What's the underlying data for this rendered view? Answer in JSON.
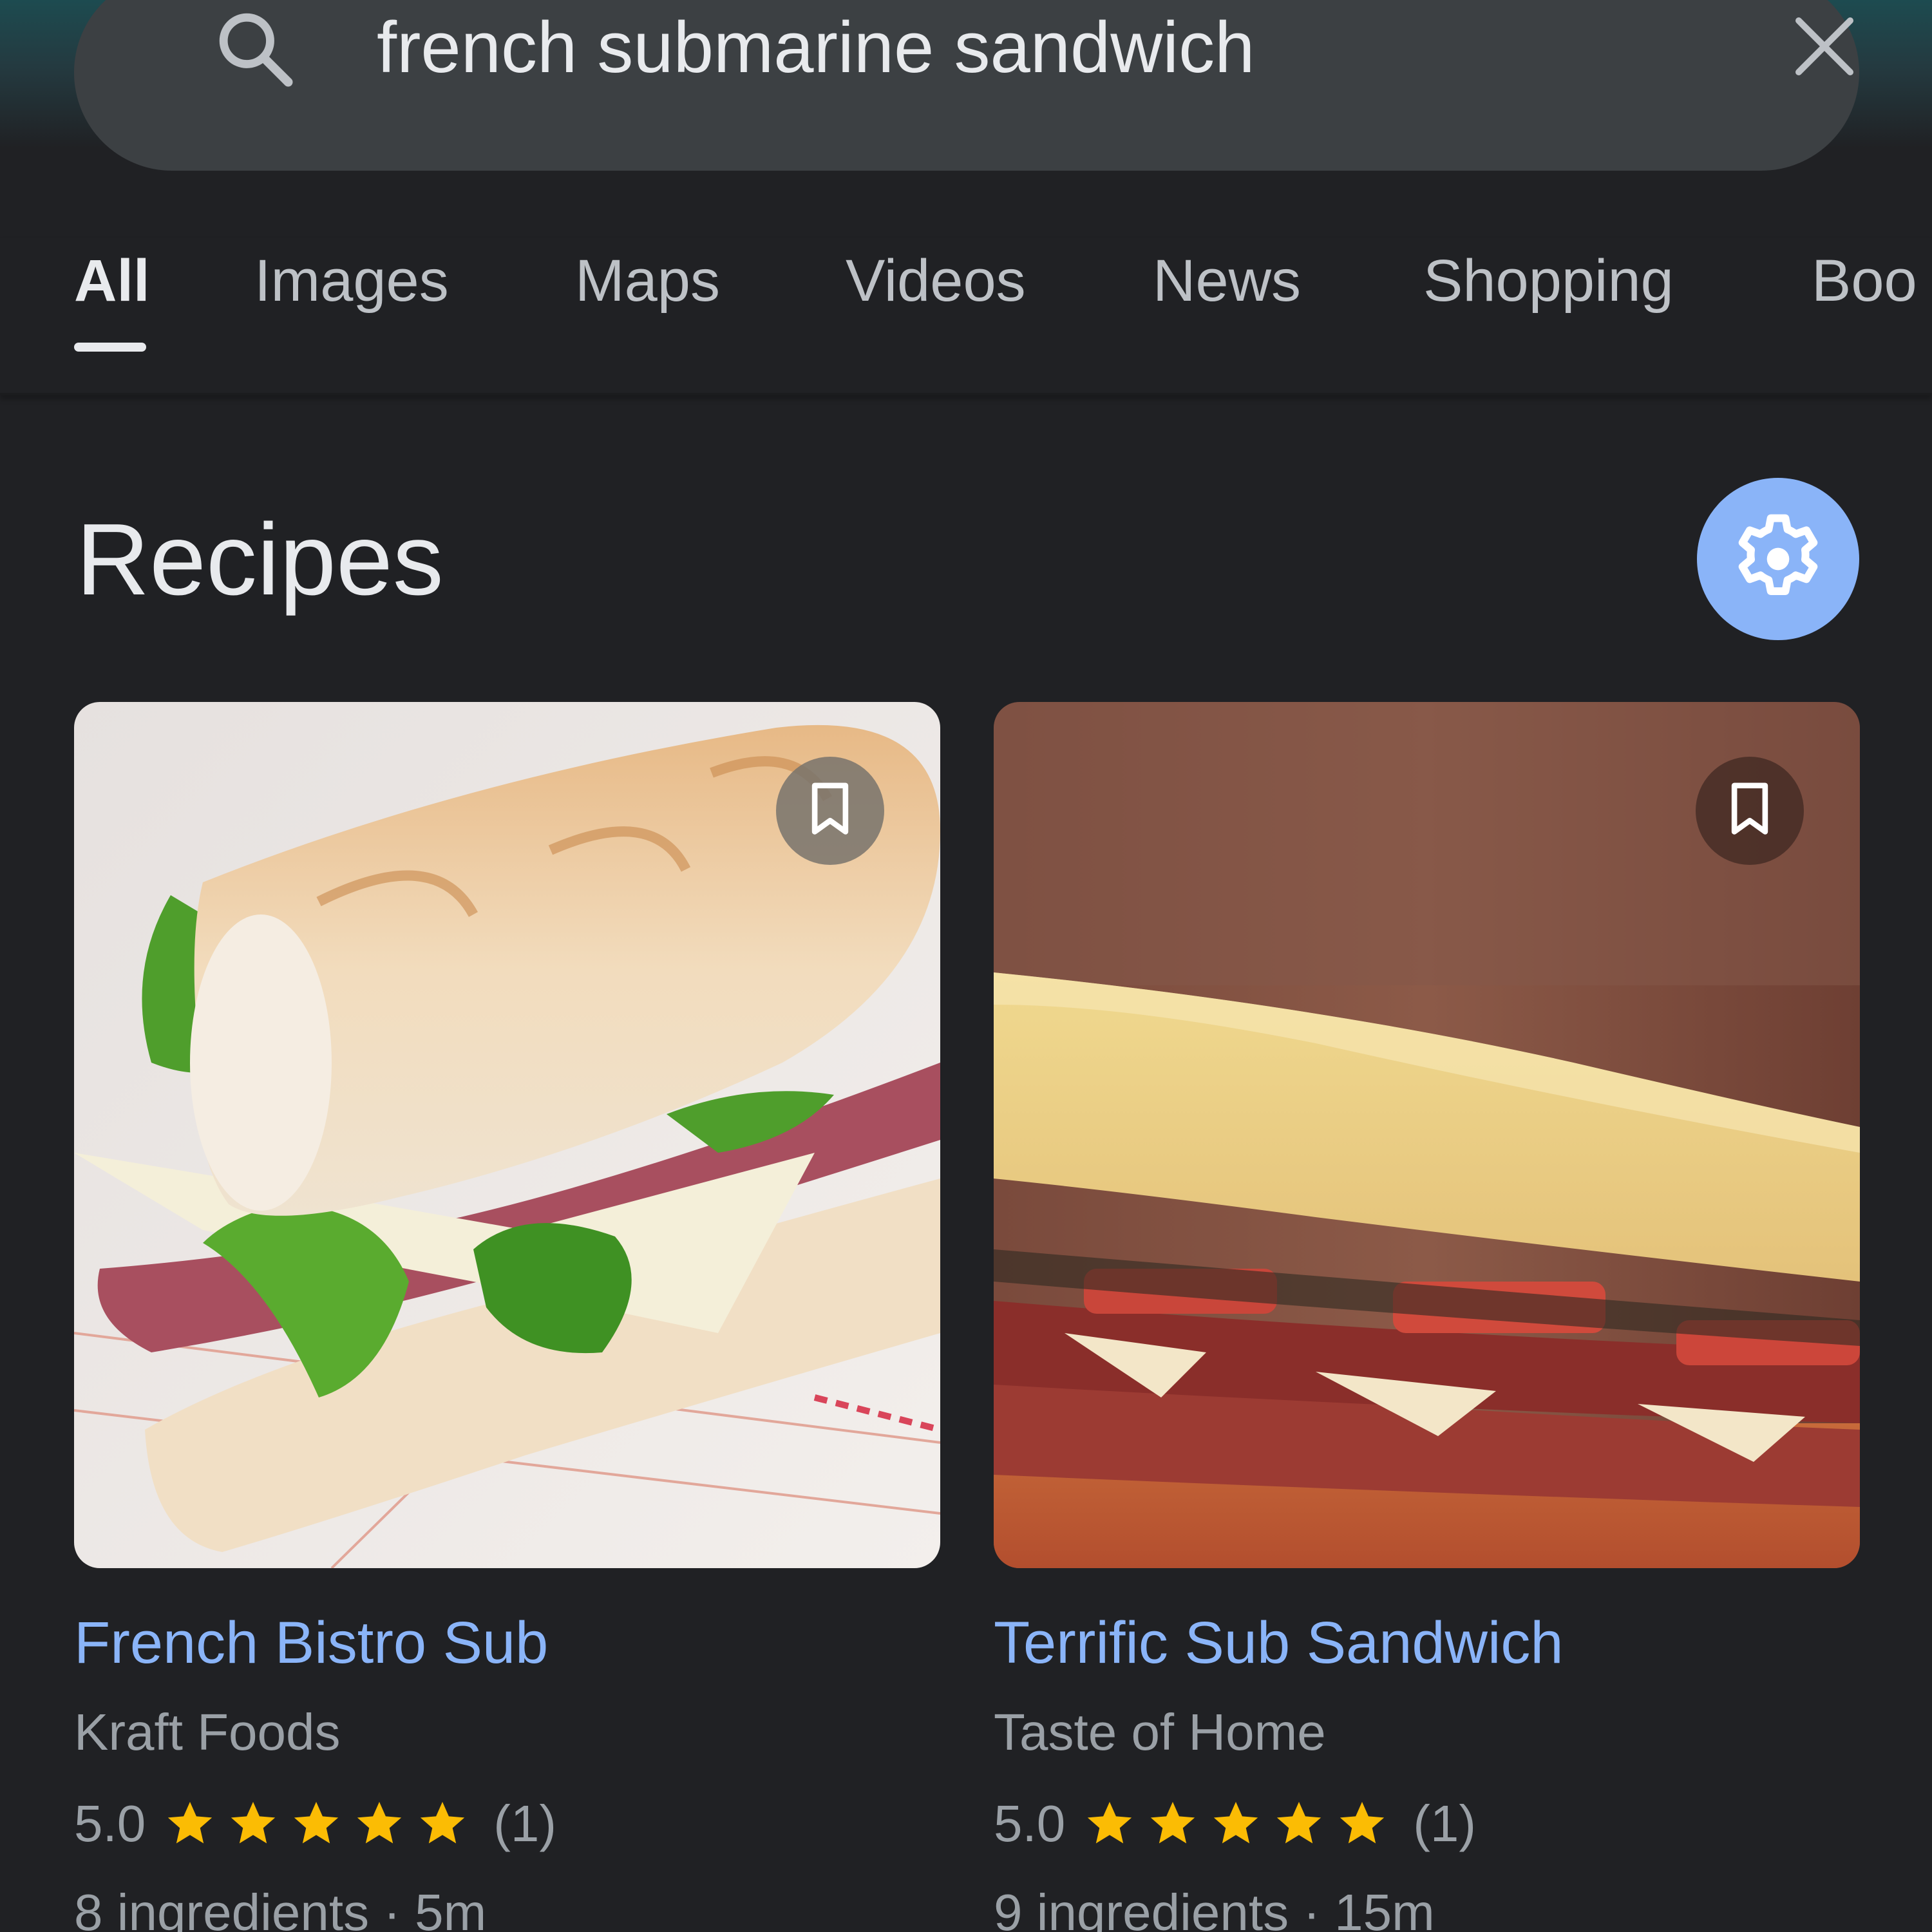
{
  "search": {
    "query": "french submarine sandwich"
  },
  "tabs": [
    {
      "label": "All",
      "active": true
    },
    {
      "label": "Images",
      "active": false
    },
    {
      "label": "Maps",
      "active": false
    },
    {
      "label": "Videos",
      "active": false
    },
    {
      "label": "News",
      "active": false
    },
    {
      "label": "Shopping",
      "active": false
    },
    {
      "label": "Boo",
      "active": false
    }
  ],
  "section": {
    "title": "Recipes",
    "settings_icon": "gear-icon"
  },
  "recipes": [
    {
      "title": "French Bistro Sub",
      "source": "Kraft Foods",
      "rating": "5.0",
      "stars": 5,
      "reviews": "(1)",
      "meta": "8 ingredients · 5m",
      "image": "sandwich-photo-baguette-roast-beef"
    },
    {
      "title": "Terrific Sub Sandwich",
      "source": "Taste of Home",
      "rating": "5.0",
      "stars": 5,
      "reviews": "(1)",
      "meta": "9 ingredients · 15m",
      "image": "sandwich-photo-sub-cold-cuts"
    }
  ],
  "colors": {
    "background": "#202124",
    "search_bar": "#3c4043",
    "link": "#8ab4f8",
    "star": "#fbbc04",
    "secondary_text": "#9aa0a6"
  }
}
